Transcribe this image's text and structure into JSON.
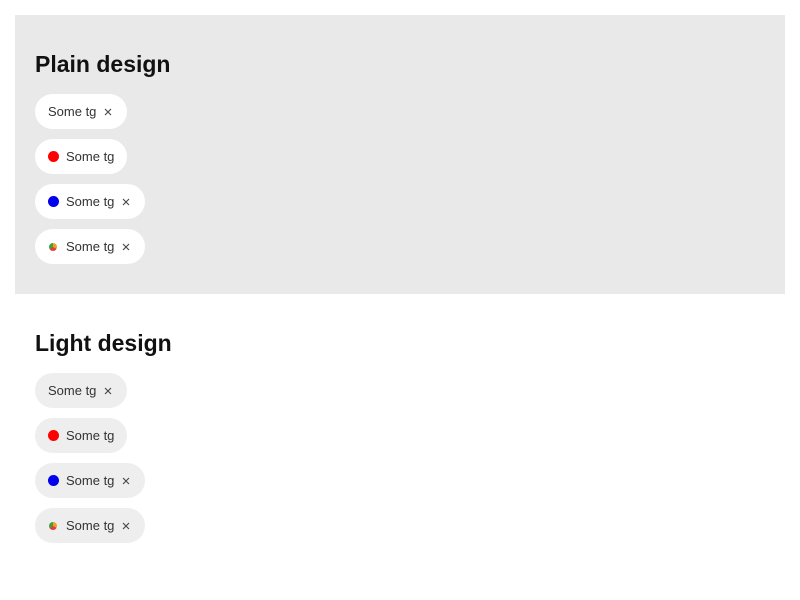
{
  "colors": {
    "plain_background": "#e9e9e9",
    "light_background": "#ffffff",
    "red_dot": "#ff0000",
    "blue_dot": "#0000ee",
    "multicolor_dot": [
      "#f0a020",
      "#e04040",
      "#40a040"
    ]
  },
  "sections": [
    {
      "title": "Plain design",
      "tags": [
        {
          "label": "Some tg",
          "dot": null,
          "removable": true
        },
        {
          "label": "Some tg",
          "dot": "red",
          "removable": false
        },
        {
          "label": "Some tg",
          "dot": "blue",
          "removable": true
        },
        {
          "label": "Some tg",
          "dot": "multicolor",
          "removable": true
        }
      ]
    },
    {
      "title": "Light design",
      "tags": [
        {
          "label": "Some tg",
          "dot": null,
          "removable": true
        },
        {
          "label": "Some tg",
          "dot": "red",
          "removable": false
        },
        {
          "label": "Some tg",
          "dot": "blue",
          "removable": true
        },
        {
          "label": "Some tg",
          "dot": "multicolor",
          "removable": true
        }
      ]
    }
  ]
}
